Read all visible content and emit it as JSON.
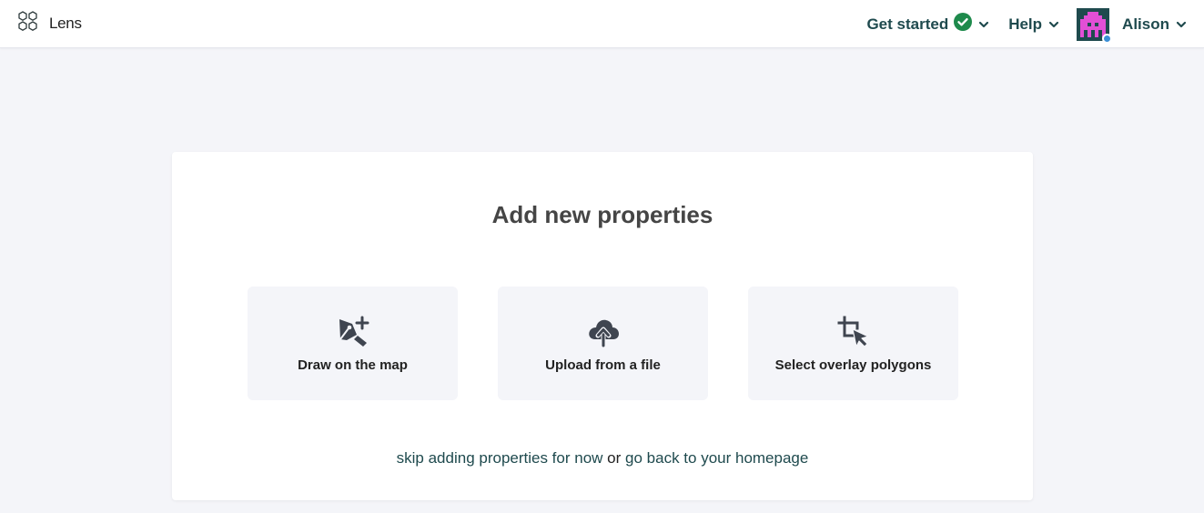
{
  "header": {
    "brand_name": "Lens",
    "nav": {
      "get_started_label": "Get started",
      "help_label": "Help",
      "user_name": "Alison"
    },
    "colors": {
      "nav_text": "#1f4a4e",
      "check_green": "#1e8a4c",
      "avatar_bg": "#1f4a4e",
      "avatar_pattern": "#e24fd6"
    }
  },
  "main": {
    "title": "Add new properties",
    "options": [
      {
        "label": "Draw on the map",
        "icon": "pen-add-icon"
      },
      {
        "label": "Upload from a file",
        "icon": "cloud-upload-icon"
      },
      {
        "label": "Select overlay polygons",
        "icon": "crop-cursor-icon"
      }
    ],
    "footer": {
      "skip_link": "skip adding properties for now",
      "connector": "or",
      "home_link": "go back to your homepage"
    }
  }
}
